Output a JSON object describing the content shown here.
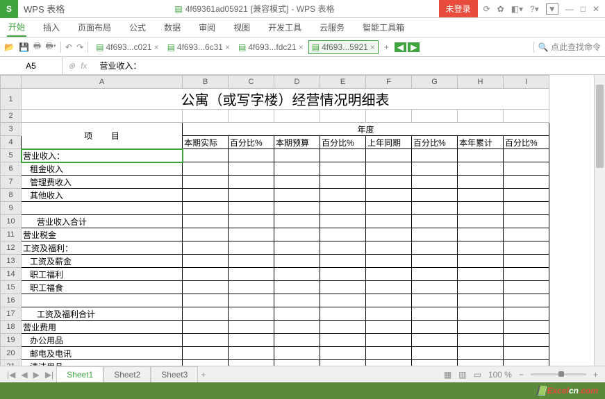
{
  "app": {
    "name": "WPS 表格",
    "logo": "S"
  },
  "title": {
    "filename": "4f69361ad05921",
    "mode": "[兼容模式]",
    "suffix": "- WPS 表格"
  },
  "login": {
    "label": "未登录"
  },
  "menu": {
    "items": [
      "开始",
      "插入",
      "页面布局",
      "公式",
      "数据",
      "审阅",
      "视图",
      "开发工具",
      "云服务",
      "智能工具箱"
    ],
    "active": 0
  },
  "doc_tabs": [
    {
      "label": "4f693...c021",
      "active": false
    },
    {
      "label": "4f693...6c31",
      "active": false
    },
    {
      "label": "4f693...fdc21",
      "active": false
    },
    {
      "label": "4f693...5921",
      "active": true
    }
  ],
  "search": {
    "placeholder": "点此查找命令"
  },
  "formula_bar": {
    "cell_ref": "A5",
    "content": "营业收入："
  },
  "columns": [
    "A",
    "B",
    "C",
    "D",
    "E",
    "F",
    "G",
    "H",
    "I"
  ],
  "sheet": {
    "title": "公寓（或写字楼）经营情况明细表",
    "header_top": "年度",
    "headers": {
      "A": "项        目",
      "B": "本期实际",
      "C": "百分比%",
      "D": "本期预算",
      "E": "百分比%",
      "F": "上年同期",
      "G": "百分比%",
      "H": "本年累计",
      "I": "百分比%"
    },
    "rows": {
      "5": "营业收入：",
      "6": "   租金收入",
      "7": "   管理费收入",
      "8": "   其他收入",
      "9": "",
      "10": "      营业收入合计",
      "11": "营业税金",
      "12": "工资及福利：",
      "13": "   工资及薪金",
      "14": "   职工福利",
      "15": "   职工福食",
      "16": "",
      "17": "      工资及福利合计",
      "18": "营业费用",
      "19": "   办公用品",
      "20": "   邮电及电讯",
      "21": "   清洁用品"
    }
  },
  "sheet_tabs": {
    "items": [
      "Sheet1",
      "Sheet2",
      "Sheet3"
    ],
    "active": 0
  },
  "status": {
    "zoom": "100 %"
  },
  "watermark": {
    "text1": "Excel",
    "text2": "cn",
    "text3": ".com"
  }
}
